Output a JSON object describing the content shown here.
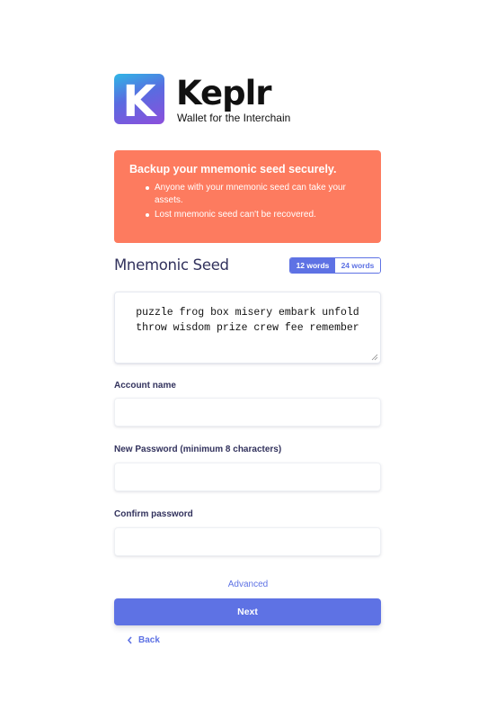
{
  "brand": {
    "name": "Keplr",
    "tagline": "Wallet for the Interchain",
    "logo_letter": "K"
  },
  "warning": {
    "title": "Backup your mnemonic seed securely.",
    "items": [
      "Anyone with your mnemonic seed can take your assets.",
      "Lost mnemonic seed can't be recovered."
    ]
  },
  "mnemonic": {
    "title": "Mnemonic Seed",
    "toggle": [
      "12 words",
      "24 words"
    ],
    "selected": "12 words",
    "seed_text": "puzzle frog box misery embark unfold throw wisdom prize crew fee remember"
  },
  "fields": {
    "account_name_label": "Account name",
    "account_name_value": "",
    "password_label": "New Password (minimum 8 characters)",
    "password_value": "",
    "confirm_label": "Confirm password",
    "confirm_value": ""
  },
  "actions": {
    "advanced": "Advanced",
    "next": "Next",
    "back": "Back"
  },
  "colors": {
    "primary": "#5e72e4",
    "warning_bg": "#fd7b5f",
    "text": "#32325d"
  }
}
